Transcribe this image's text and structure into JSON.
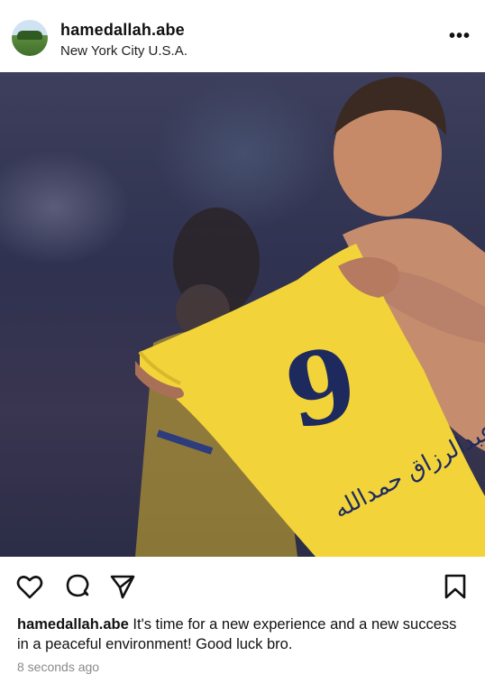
{
  "post": {
    "username": "hamedallah.abe",
    "location": "New York City U.S.A.",
    "caption_user": "hamedallah.abe",
    "caption_text": "It's time for a new experience and a new success in a peaceful environment! Good luck bro.",
    "timestamp": "8 seconds ago"
  },
  "photo": {
    "jersey_number": "9",
    "jersey_name": "عبدالرزاق حمدالله",
    "jersey_color": "#f2d43a",
    "number_color": "#1e2a5e"
  },
  "icons": {
    "more": "more-options-icon",
    "like": "heart-icon",
    "comment": "comment-icon",
    "share": "send-icon",
    "save": "bookmark-icon"
  }
}
